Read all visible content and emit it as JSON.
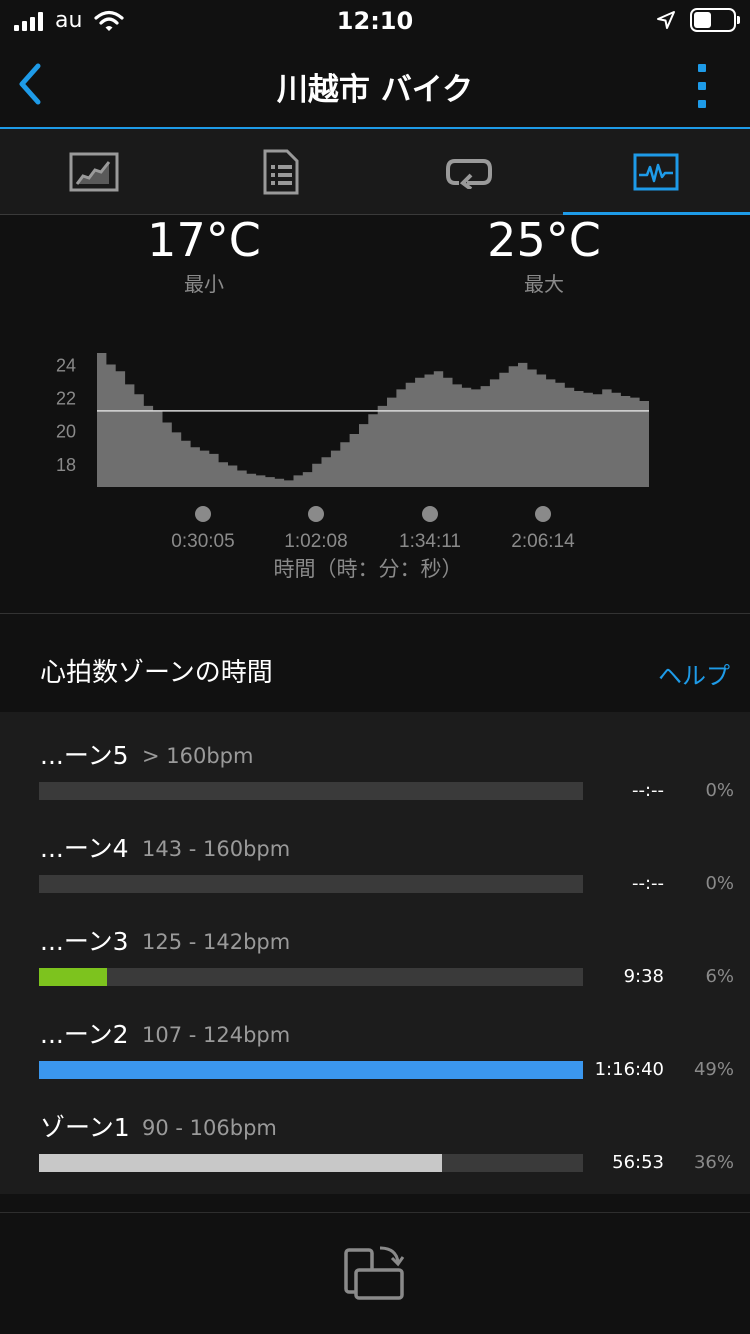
{
  "status_bar": {
    "carrier": "au",
    "time": "12:10"
  },
  "nav": {
    "title": "川越市 バイク"
  },
  "tabs": [
    {
      "icon": "map-chart-icon"
    },
    {
      "icon": "document-list-icon"
    },
    {
      "icon": "laps-loop-icon"
    },
    {
      "icon": "activity-graph-icon",
      "active": true
    }
  ],
  "temperature": {
    "min_value": "17°C",
    "min_label": "最小",
    "max_value": "25°C",
    "max_label": "最大"
  },
  "chart_data": {
    "type": "area",
    "xlabel": "時間（時：分：秒）",
    "ylabel": "",
    "y_ticks": [
      "24",
      "22",
      "20",
      "18"
    ],
    "x_ticks": [
      "0:30:05",
      "1:02:08",
      "1:34:11",
      "2:06:14"
    ],
    "ylim": [
      16.6,
      25
    ],
    "average_line": 21.2,
    "fill_color": "#6f6f6f",
    "line_color": "#d9d9d9",
    "x_seconds_range": [
      0,
      9000
    ],
    "series": [
      {
        "values": [
          24.7,
          24,
          23.6,
          22.8,
          22.2,
          21.5,
          21.2,
          20.5,
          19.9,
          19.4,
          19,
          18.8,
          18.6,
          18.1,
          17.9,
          17.6,
          17.4,
          17.3,
          17.2,
          17.1,
          17,
          17.3,
          17.5,
          18,
          18.4,
          18.8,
          19.3,
          19.8,
          20.4,
          21,
          21.5,
          22,
          22.5,
          22.9,
          23.2,
          23.4,
          23.6,
          23.2,
          22.8,
          22.6,
          22.5,
          22.7,
          23.1,
          23.5,
          23.9,
          24.1,
          23.7,
          23.4,
          23.1,
          22.9,
          22.6,
          22.4,
          22.3,
          22.2,
          22.5,
          22.3,
          22.1,
          22,
          21.8
        ]
      }
    ]
  },
  "zones": {
    "title": "心拍数ゾーンの時間",
    "help": "ヘルプ",
    "items": [
      {
        "name": "...ーン5",
        "range": "> 160bpm",
        "time": "--:--",
        "pct": "0%",
        "fraction": 0,
        "color": "#3a3a3a"
      },
      {
        "name": "...ーン4",
        "range": "143 - 160bpm",
        "time": "--:--",
        "pct": "0%",
        "fraction": 0,
        "color": "#3a3a3a"
      },
      {
        "name": "...ーン3",
        "range": "125 - 142bpm",
        "time": "9:38",
        "pct": "6%",
        "fraction": 0.125,
        "color": "#7dc31e"
      },
      {
        "name": "...ーン2",
        "range": "107 - 124bpm",
        "time": "1:16:40",
        "pct": "49%",
        "fraction": 1.0,
        "color": "#3b97ee"
      },
      {
        "name": "ゾーン1",
        "range": "90 - 106bpm",
        "time": "56:53",
        "pct": "36%",
        "fraction": 0.74,
        "color": "#c8c8c8"
      }
    ]
  },
  "colors": {
    "accent": "#1e9be8",
    "background": "#111111",
    "tab_bg": "#1a1a1a"
  }
}
